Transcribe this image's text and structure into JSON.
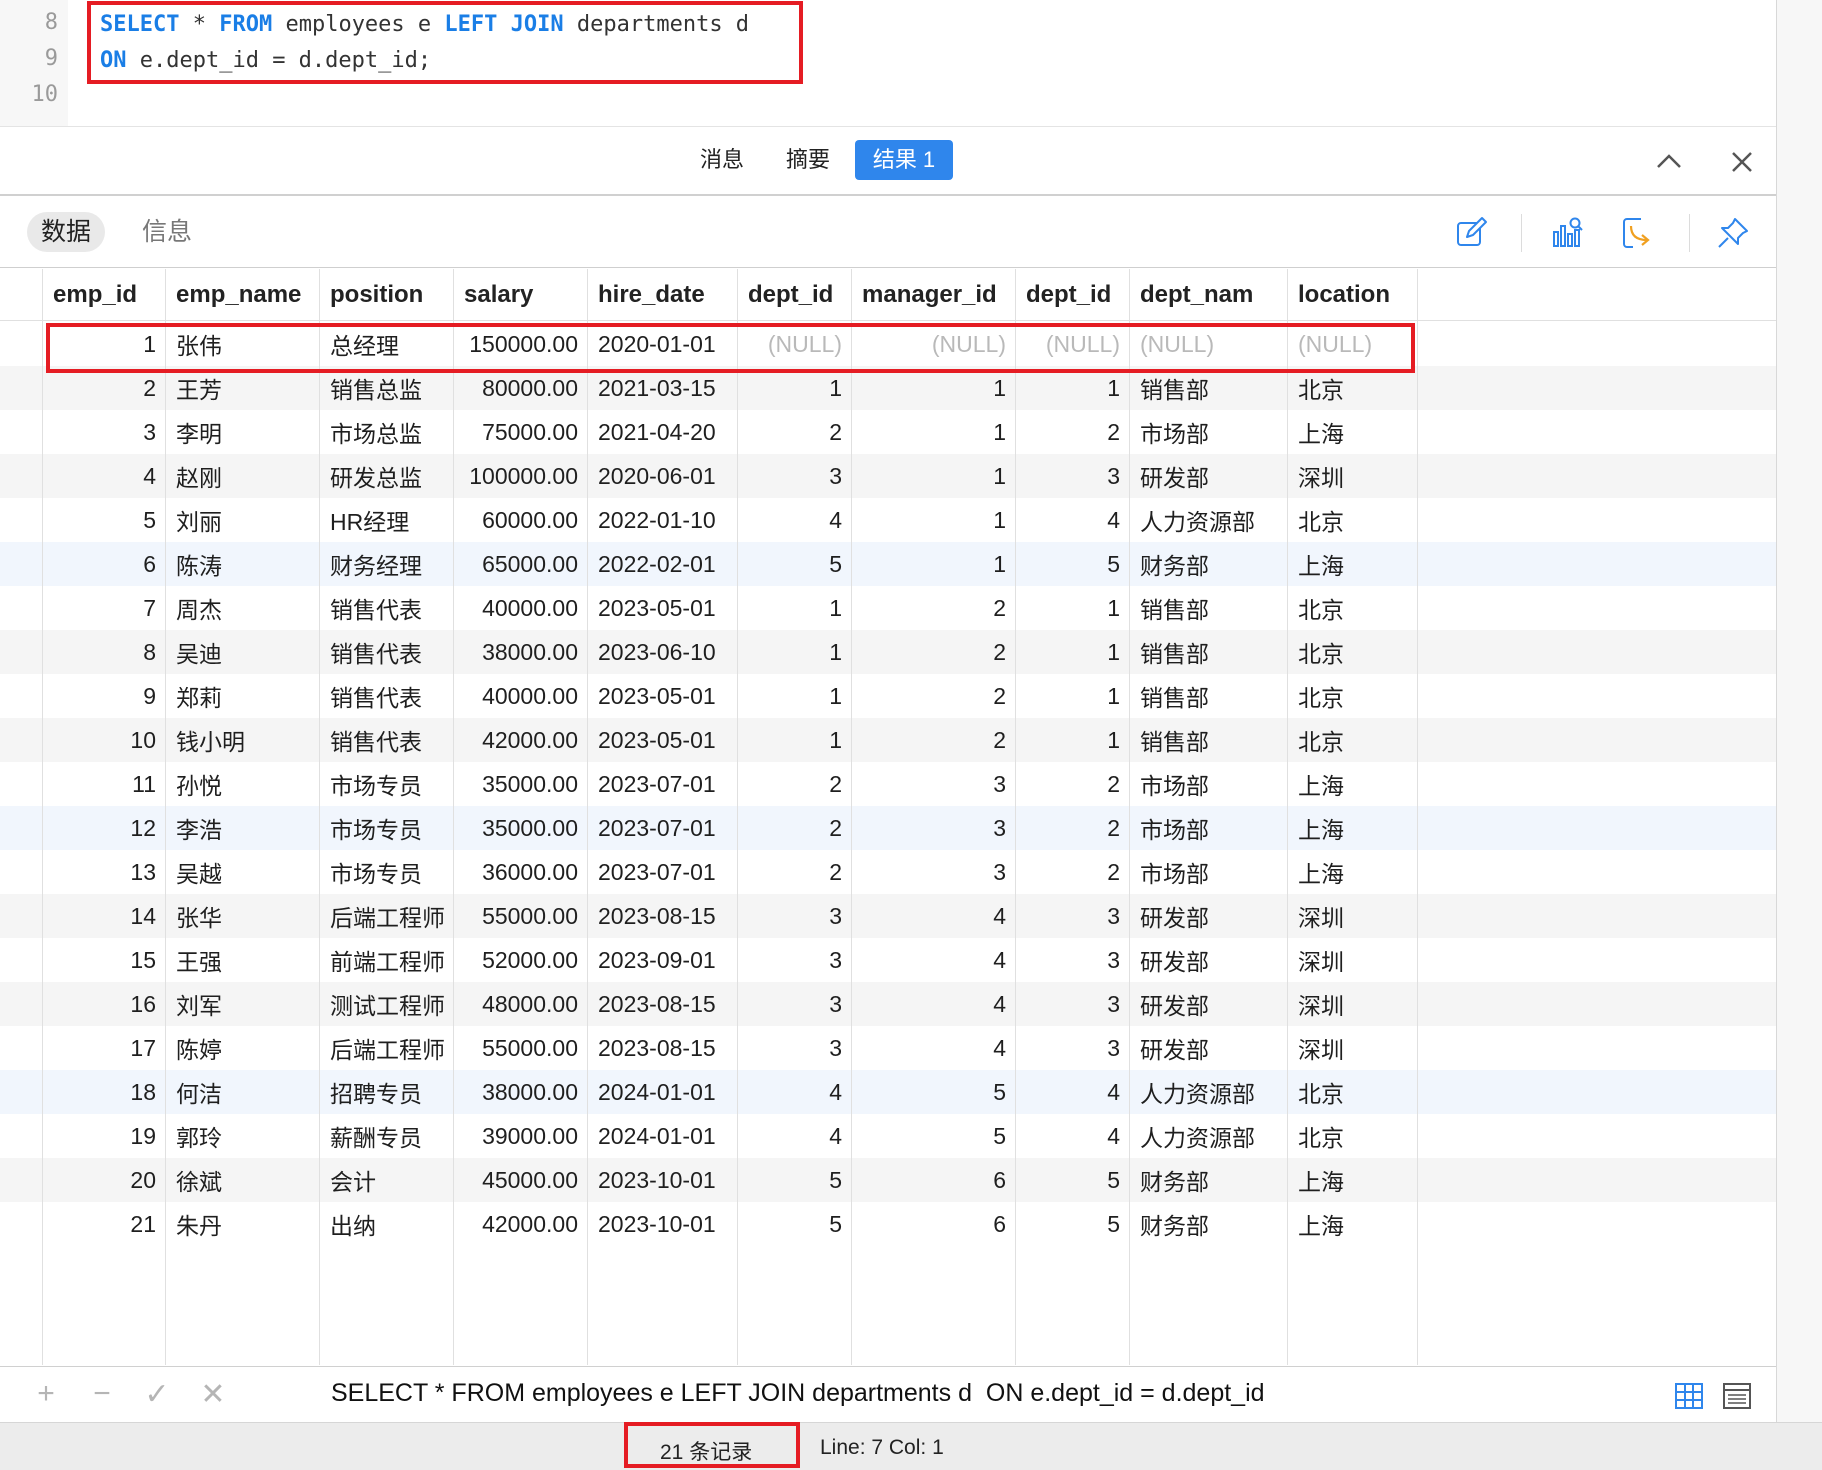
{
  "editor": {
    "lines": [
      {
        "num": "8",
        "kw1": "SELECT",
        "t1": " * ",
        "kw2": "FROM",
        "t2": " employees e ",
        "kw3": "LEFT JOIN",
        "t3": " departments d"
      },
      {
        "num": "9",
        "kw1": "ON",
        "t1": " e.dept_id = d.dept_id;"
      },
      {
        "num": "10"
      }
    ]
  },
  "result_tabs": {
    "messages": "消息",
    "summary": "摘要",
    "result1": "结果 1"
  },
  "sub_tabs": {
    "data": "数据",
    "info": "信息"
  },
  "icons": {
    "collapse": "chevron-up-icon",
    "close": "close-icon",
    "edit": "edit-icon",
    "chart": "chart-search-icon",
    "export": "export-icon",
    "pin": "pin-icon",
    "grid_view": "grid-view-icon",
    "form_view": "form-view-icon",
    "add": "plus-icon",
    "delete": "minus-icon",
    "apply": "check-icon",
    "discard": "x-icon"
  },
  "grid": {
    "columns": [
      "emp_id",
      "emp_name",
      "position",
      "salary",
      "hire_date",
      "dept_id",
      "manager_id",
      "dept_id",
      "dept_nam",
      "location"
    ],
    "rows": [
      [
        "1",
        "张伟",
        "总经理",
        "150000.00",
        "2020-01-01",
        "(NULL)",
        "(NULL)",
        "(NULL)",
        "(NULL)",
        "(NULL)"
      ],
      [
        "2",
        "王芳",
        "销售总监",
        "80000.00",
        "2021-03-15",
        "1",
        "1",
        "1",
        "销售部",
        "北京"
      ],
      [
        "3",
        "李明",
        "市场总监",
        "75000.00",
        "2021-04-20",
        "2",
        "1",
        "2",
        "市场部",
        "上海"
      ],
      [
        "4",
        "赵刚",
        "研发总监",
        "100000.00",
        "2020-06-01",
        "3",
        "1",
        "3",
        "研发部",
        "深圳"
      ],
      [
        "5",
        "刘丽",
        "HR经理",
        "60000.00",
        "2022-01-10",
        "4",
        "1",
        "4",
        "人力资源部",
        "北京"
      ],
      [
        "6",
        "陈涛",
        "财务经理",
        "65000.00",
        "2022-02-01",
        "5",
        "1",
        "5",
        "财务部",
        "上海"
      ],
      [
        "7",
        "周杰",
        "销售代表",
        "40000.00",
        "2023-05-01",
        "1",
        "2",
        "1",
        "销售部",
        "北京"
      ],
      [
        "8",
        "吴迪",
        "销售代表",
        "38000.00",
        "2023-06-10",
        "1",
        "2",
        "1",
        "销售部",
        "北京"
      ],
      [
        "9",
        "郑莉",
        "销售代表",
        "40000.00",
        "2023-05-01",
        "1",
        "2",
        "1",
        "销售部",
        "北京"
      ],
      [
        "10",
        "钱小明",
        "销售代表",
        "42000.00",
        "2023-05-01",
        "1",
        "2",
        "1",
        "销售部",
        "北京"
      ],
      [
        "11",
        "孙悦",
        "市场专员",
        "35000.00",
        "2023-07-01",
        "2",
        "3",
        "2",
        "市场部",
        "上海"
      ],
      [
        "12",
        "李浩",
        "市场专员",
        "35000.00",
        "2023-07-01",
        "2",
        "3",
        "2",
        "市场部",
        "上海"
      ],
      [
        "13",
        "吴越",
        "市场专员",
        "36000.00",
        "2023-07-01",
        "2",
        "3",
        "2",
        "市场部",
        "上海"
      ],
      [
        "14",
        "张华",
        "后端工程师",
        "55000.00",
        "2023-08-15",
        "3",
        "4",
        "3",
        "研发部",
        "深圳"
      ],
      [
        "15",
        "王强",
        "前端工程师",
        "52000.00",
        "2023-09-01",
        "3",
        "4",
        "3",
        "研发部",
        "深圳"
      ],
      [
        "16",
        "刘军",
        "测试工程师",
        "48000.00",
        "2023-08-15",
        "3",
        "4",
        "3",
        "研发部",
        "深圳"
      ],
      [
        "17",
        "陈婷",
        "后端工程师",
        "55000.00",
        "2023-08-15",
        "3",
        "4",
        "3",
        "研发部",
        "深圳"
      ],
      [
        "18",
        "何洁",
        "招聘专员",
        "38000.00",
        "2024-01-01",
        "4",
        "5",
        "4",
        "人力资源部",
        "北京"
      ],
      [
        "19",
        "郭玲",
        "薪酬专员",
        "39000.00",
        "2024-01-01",
        "4",
        "5",
        "4",
        "人力资源部",
        "北京"
      ],
      [
        "20",
        "徐斌",
        "会计",
        "45000.00",
        "2023-10-01",
        "5",
        "6",
        "5",
        "财务部",
        "上海"
      ],
      [
        "21",
        "朱丹",
        "出纳",
        "42000.00",
        "2023-10-01",
        "5",
        "6",
        "5",
        "财务部",
        "上海"
      ]
    ]
  },
  "bottom_bar": {
    "sql": "SELECT * FROM employees e LEFT JOIN departments d  ON e.dept_id = d.dept_id"
  },
  "status": {
    "records": "21 条记录",
    "position": "Line: 7  Col: 1"
  },
  "colors": {
    "accent": "#2f86ec",
    "highlight": "#e51c23",
    "keyword": "#1a7ee6",
    "null_text": "#b9b9b9"
  }
}
